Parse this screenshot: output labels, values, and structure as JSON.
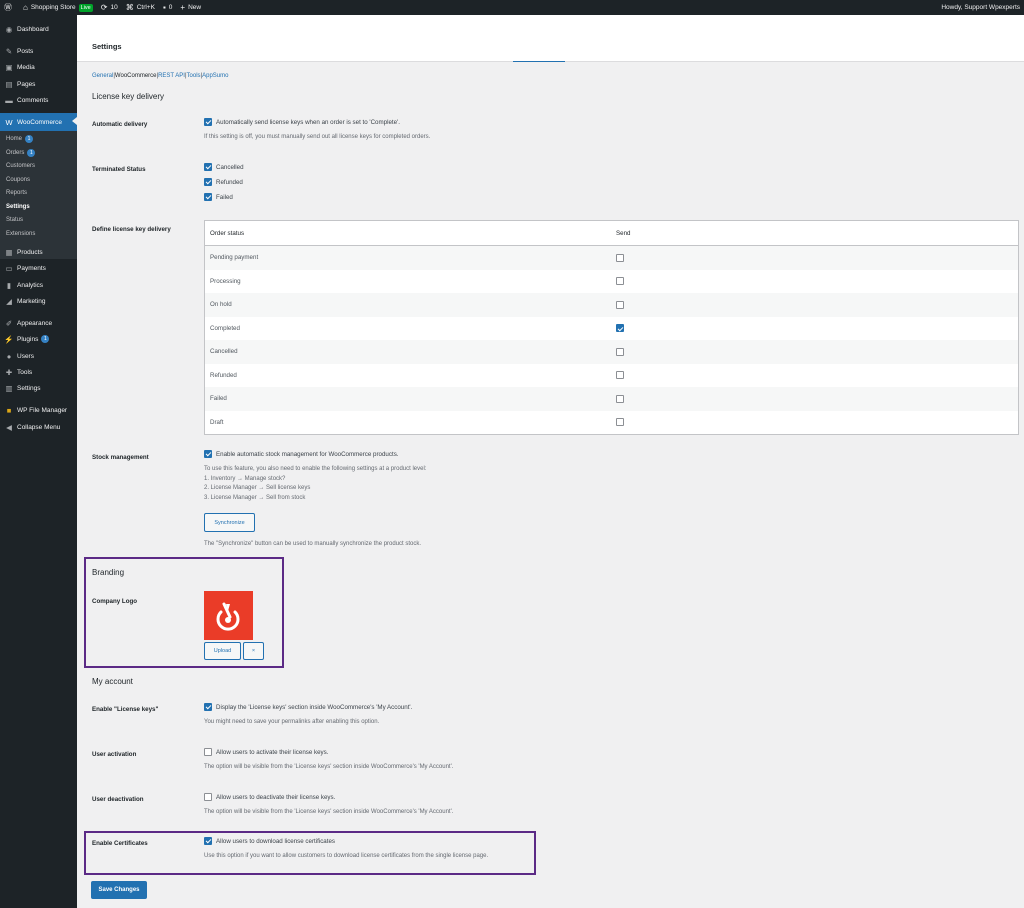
{
  "adminbar": {
    "site_name": "Shopping Store",
    "live_label": "Live",
    "updates_count": "10",
    "shortcut": "Ctrl+K",
    "comments_count": "0",
    "new_label": "New",
    "howdy": "Howdy, Support Wpexperts"
  },
  "sidebar": {
    "dashboard": "Dashboard",
    "posts": "Posts",
    "media": "Media",
    "pages": "Pages",
    "comments": "Comments",
    "woocommerce": "WooCommerce",
    "sub": {
      "home": "Home",
      "home_badge": "1",
      "orders": "Orders",
      "orders_badge": "1",
      "customers": "Customers",
      "coupons": "Coupons",
      "reports": "Reports",
      "settings": "Settings",
      "status": "Status",
      "extensions": "Extensions"
    },
    "products": "Products",
    "payments": "Payments",
    "analytics": "Analytics",
    "marketing": "Marketing",
    "appearance": "Appearance",
    "plugins": "Plugins",
    "plugins_badge": "1",
    "users": "Users",
    "tools": "Tools",
    "settings": "Settings",
    "wp_file_manager": "WP File Manager",
    "collapse": "Collapse Menu"
  },
  "header": {
    "title": "Settings"
  },
  "subnav": {
    "general": "General",
    "sep1": " |",
    "woocommerce": "WooCommerce",
    "sep2": " |",
    "rest_api": "REST API",
    "sep3": " |",
    "tools": "Tools",
    "sep4": " |",
    "appsumo": "AppSumo"
  },
  "license": {
    "section_title": "License key delivery",
    "auto_label": "Automatic delivery",
    "auto_text": "Automatically send license keys when an order is set to 'Complete'.",
    "auto_desc": "If this setting is off, you must manually send out all license keys for completed orders.",
    "terminated_label": "Terminated Status",
    "terminated": [
      "Cancelled",
      "Refunded",
      "Failed"
    ],
    "define_label": "Define license key delivery",
    "table_headers": [
      "Order status",
      "Send"
    ],
    "rows": [
      {
        "status": "Pending payment",
        "send": false
      },
      {
        "status": "Processing",
        "send": false
      },
      {
        "status": "On hold",
        "send": false
      },
      {
        "status": "Completed",
        "send": true
      },
      {
        "status": "Cancelled",
        "send": false
      },
      {
        "status": "Refunded",
        "send": false
      },
      {
        "status": "Failed",
        "send": false
      },
      {
        "status": "Draft",
        "send": false
      }
    ]
  },
  "stock": {
    "label": "Stock management",
    "text": "Enable automatic stock management for WooCommerce products.",
    "desc1": "To use this feature, you also need to enable the following settings at a product level:",
    "desc2": "1. Inventory → Manage stock?",
    "desc3": "2. License Manager → Sell license keys",
    "desc4": "3. License Manager → Sell from stock",
    "sync_button": "Synchronize",
    "sync_desc": "The \"Synchronize\" button can be used to manually synchronize the product stock."
  },
  "branding": {
    "title": "Branding",
    "logo_label": "Company Logo",
    "upload_button": "Upload",
    "remove_button": "×"
  },
  "account": {
    "title": "My account",
    "enable_label": "Enable \"License keys\"",
    "enable_text": "Display the 'License keys' section inside WooCommerce's 'My Account'.",
    "enable_desc": "You might need to save your permalinks after enabling this option.",
    "activation_label": "User activation",
    "activation_text": "Allow users to activate their license keys.",
    "activation_desc": "The option will be visible from the 'License keys' section inside WooCommerce's 'My Account'.",
    "deactivation_label": "User deactivation",
    "deactivation_text": "Allow users to deactivate their license keys.",
    "deactivation_desc": "The option will be visible from the 'License keys' section inside WooCommerce's 'My Account'.",
    "cert_label": "Enable Certificates",
    "cert_text": "Allow users to download license certificates",
    "cert_desc": "Use this option if you want to allow customers to download license certificates from the single license page."
  },
  "save_button": "Save Changes",
  "colors": {
    "accent": "#2271b1",
    "highlight_box": "#5b2a86",
    "logo_bg": "#ea3c28"
  }
}
